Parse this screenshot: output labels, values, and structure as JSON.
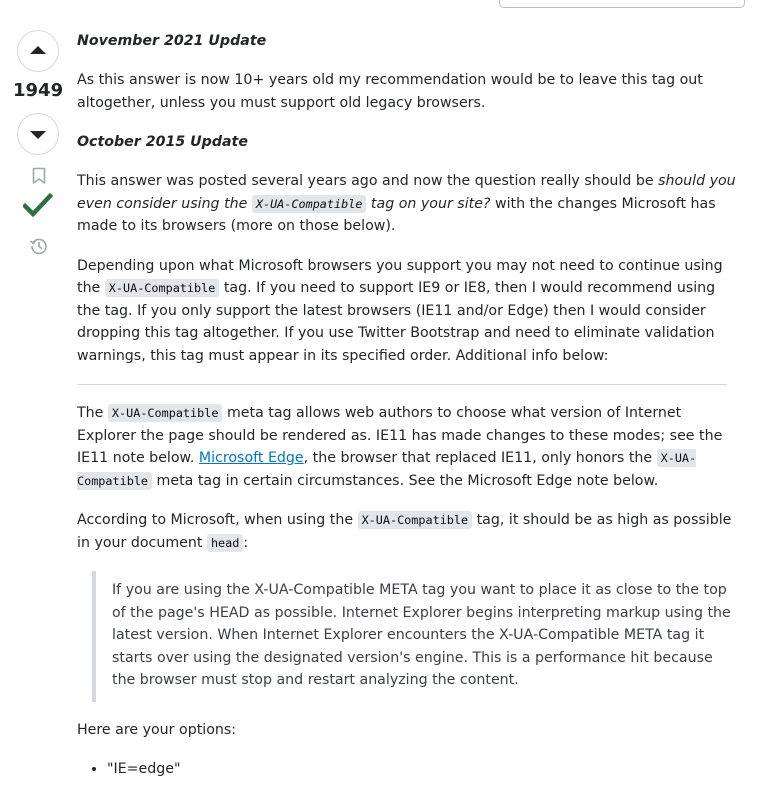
{
  "vote": {
    "count": "1949",
    "upvote_icon": "triangle-up-icon",
    "downvote_icon": "triangle-down-icon",
    "bookmark_icon": "bookmark-icon",
    "accepted_icon": "checkmark-icon",
    "history_icon": "history-icon",
    "accent_color": "#2f6f44"
  },
  "post": {
    "h1": "November 2021 Update",
    "p1": "As this answer is now 10+ years old my recommendation would be to leave this tag out altogether, unless you must support old legacy browsers.",
    "h2": "October 2015 Update",
    "p2": {
      "a": "This answer was posted several years ago and now the question really should be ",
      "b": "should you even consider using the ",
      "code": "X-UA-Compatible",
      "c": " tag on your site?",
      "d": " with the changes Microsoft has made to its browsers (more on those below)."
    },
    "p3": {
      "a": "Depending upon what Microsoft browsers you support you may not need to continue using the ",
      "code": "X-UA-Compatible",
      "b": " tag. If you need to support IE9 or IE8, then I would recommend using the tag. If you only support the latest browsers (IE11 and/or Edge) then I would consider dropping this tag altogether. If you use Twitter Bootstrap and need to eliminate validation warnings, this tag must appear in its specified order. Additional info below:"
    },
    "p4": {
      "a": "The ",
      "code1": "X-UA-Compatible",
      "b": " meta tag allows web authors to choose what version of Internet Explorer the page should be rendered as. IE11 has made changes to these modes; see the IE11 note below. ",
      "link": "Microsoft Edge",
      "c": ", the browser that replaced IE11, only honors the ",
      "code2": "X-UA-Compatible",
      "d": " meta tag in certain circumstances. See the Microsoft Edge note below."
    },
    "p5": {
      "a": "According to Microsoft, when using the ",
      "code1": "X-UA-Compatible",
      "b": " tag, it should be as high as possible in your document ",
      "code2": "head",
      "c": ":"
    },
    "quote": "If you are using the X-UA-Compatible META tag you want to place it as close to the top of the page's HEAD as possible. Internet Explorer begins interpreting markup using the latest version. When Internet Explorer encounters the X-UA-Compatible META tag it starts over using the designated version's engine. This is a performance hit because the browser must stop and restart analyzing the content.",
    "p6": "Here are your options:",
    "options": [
      "\"IE=edge\""
    ]
  }
}
